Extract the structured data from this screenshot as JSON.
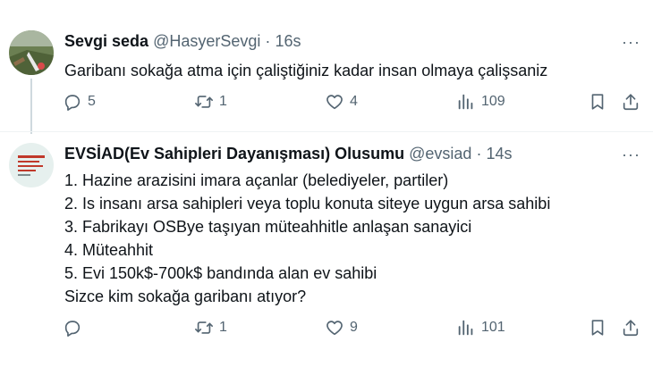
{
  "tweets": [
    {
      "display_name": "Sevgi seda",
      "handle": "@HasyerSevgi",
      "separator": "·",
      "time": "16s",
      "more": "···",
      "lines": [
        "Garibanı sokağa atma için çaliştiğiniz kadar insan olmaya çalişsaniz"
      ],
      "replies": "5",
      "retweets": "1",
      "likes": "4",
      "views": "109"
    },
    {
      "display_name": "EVSİAD(Ev Sahipleri Dayanışması) Olusumu",
      "handle": "@evsiad",
      "separator": "·",
      "time": "14s",
      "more": "···",
      "lines": [
        "1. Hazine arazisini imara açanlar (belediyeler, partiler)",
        "2. Is insanı arsa sahipleri veya toplu konuta siteye uygun arsa sahibi",
        "3. Fabrikayı OSBye taşıyan müteahhitle anlaşan sanayici",
        "4. Müteahhit",
        "5. Evi 150k$-700k$ bandında alan ev sahibi",
        "Sizce kim sokağa garibanı atıyor?"
      ],
      "replies": "",
      "retweets": "1",
      "likes": "9",
      "views": "101"
    }
  ],
  "icons": {
    "reply": "reply-icon",
    "retweet": "retweet-icon",
    "like": "heart-icon",
    "views": "views-icon",
    "bookmark": "bookmark-icon",
    "share": "share-icon"
  },
  "colors": {
    "text": "#0f1419",
    "muted": "#536471",
    "divider": "#eff3f4"
  }
}
